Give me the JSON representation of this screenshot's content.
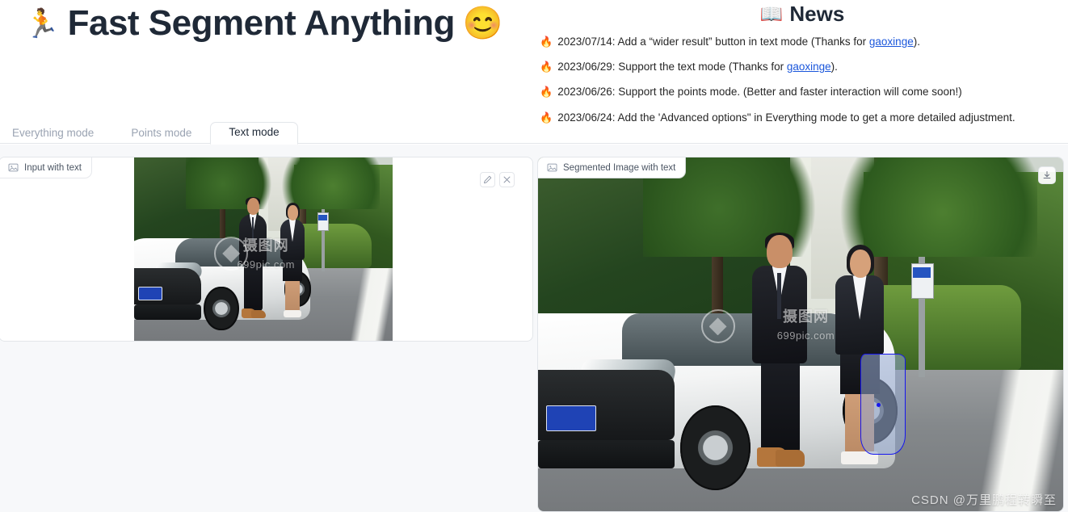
{
  "header": {
    "title": "Fast Segment Anything",
    "title_emoji_left": "🏃",
    "title_emoji_right": "😊"
  },
  "news": {
    "heading": "News",
    "heading_icon": "📖",
    "bullet_icon": "🔥",
    "items": [
      {
        "prefix": "2023/07/14: Add a “wider result” button in text mode (Thanks for ",
        "link": "gaoxinge",
        "suffix": ")."
      },
      {
        "prefix": "2023/06/29: Support the text mode (Thanks for ",
        "link": "gaoxinge",
        "suffix": ")."
      },
      {
        "prefix": "2023/06/26: Support the points mode. (Better and faster interaction will come soon!)",
        "link": "",
        "suffix": ""
      },
      {
        "prefix": "2023/06/24: Add the 'Advanced options\" in Everything mode to get a more detailed adjustment.",
        "link": "",
        "suffix": ""
      }
    ]
  },
  "tabs": [
    {
      "label": "Everything mode",
      "active": false
    },
    {
      "label": "Points mode",
      "active": false
    },
    {
      "label": "Text mode",
      "active": true
    }
  ],
  "panels": {
    "input": {
      "label": "Input with text",
      "label_icon": "image-icon",
      "edit_icon": "pencil-icon",
      "close_icon": "close-icon"
    },
    "output": {
      "label": "Segmented Image with text",
      "label_icon": "image-icon",
      "download_icon": "download-icon"
    }
  },
  "watermarks": {
    "stock_main": "摄图网",
    "stock_sub": "699pic.com",
    "csdn": "CSDN @万里鹏程转瞬至"
  },
  "colors": {
    "accent_link": "#1a56db",
    "segmentation_outline": "#1616ef",
    "page_bg": "#f7f8fa",
    "panel_border": "#e3e6ea",
    "title_text": "#1f2937",
    "tab_inactive": "#9aa3b2"
  }
}
